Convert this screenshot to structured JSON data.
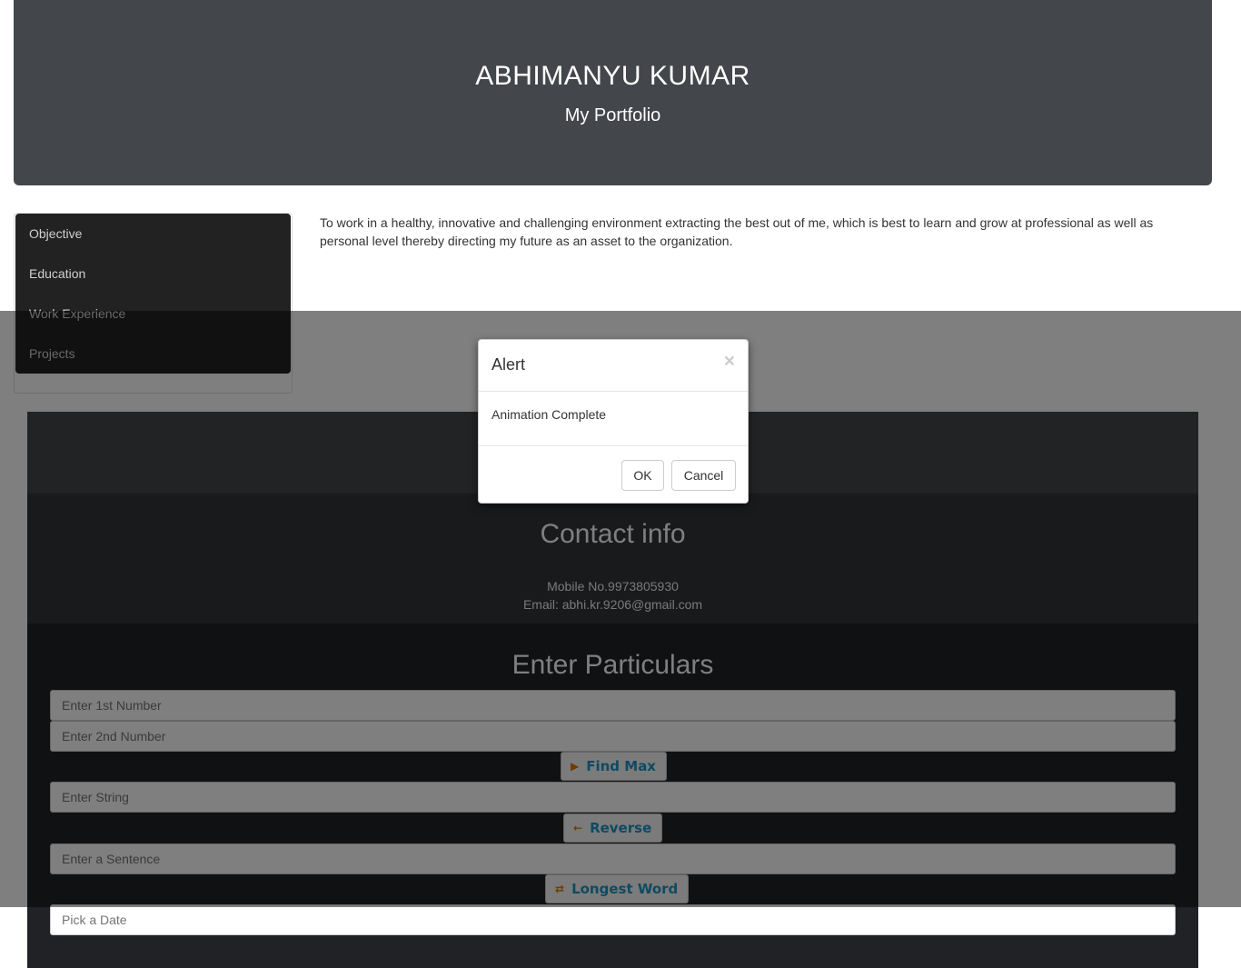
{
  "header": {
    "name": "ABHIMANYU KUMAR",
    "subtitle": "My Portfolio"
  },
  "sidebar": {
    "items": [
      {
        "label": "Objective"
      },
      {
        "label": "Education"
      },
      {
        "label": "Work Experience"
      },
      {
        "label": "Projects"
      }
    ]
  },
  "objective": {
    "text": "To work in a healthy, innovative and challenging environment extracting the best out of me, which is best to learn and grow at professional as well as personal level thereby directing my future as an asset to the organization."
  },
  "contact": {
    "title": "Contact info",
    "mobile": "Mobile No.9973805930",
    "email": "Email: abhi.kr.9206@gmail.com"
  },
  "particulars": {
    "title": "Enter Particulars",
    "first_number_placeholder": "Enter 1st Number",
    "second_number_placeholder": "Enter 2nd Number",
    "find_max_label": "Find Max",
    "string_placeholder": "Enter String",
    "reverse_label": "Reverse",
    "sentence_placeholder": "Enter a Sentence",
    "longest_word_label": "Longest Word",
    "date_placeholder": "Pick a Date"
  },
  "modal": {
    "title": "Alert",
    "close_glyph": "×",
    "message": "Animation Complete",
    "ok_label": "OK",
    "cancel_label": "Cancel"
  },
  "icons": {
    "find_max": "circle-arrow-icon",
    "reverse": "arrow-left-icon",
    "longest_word": "arrows-horizontal-icon"
  },
  "colors": {
    "header_bg": "#43464b",
    "nav_bg": "#222222",
    "button_text": "#1c94c4",
    "button_icon": "#e07b00"
  }
}
